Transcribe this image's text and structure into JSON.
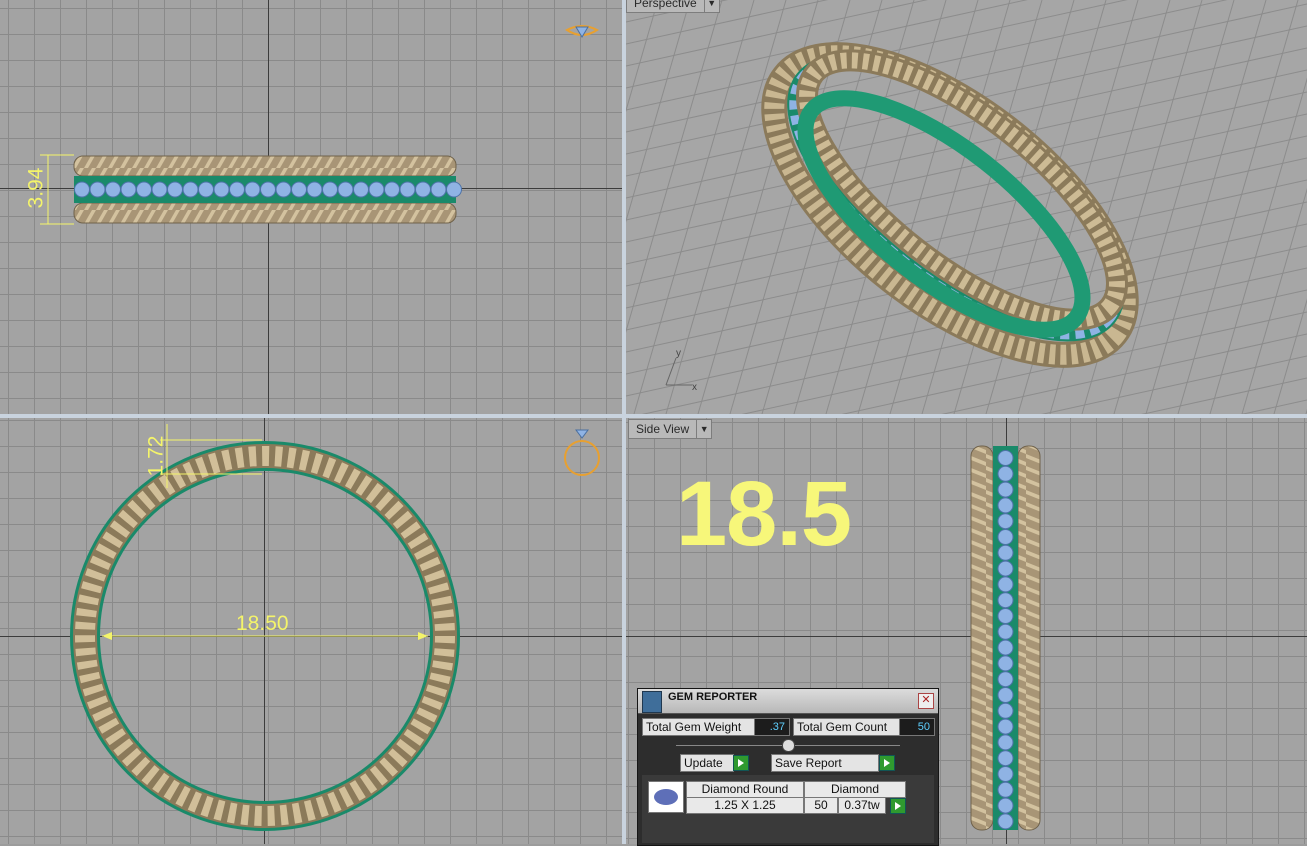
{
  "viewports": {
    "perspective_label": "Perspective",
    "side_label": "Side View"
  },
  "dimensions": {
    "width_top": "3.94",
    "thickness_front": "1.72",
    "diameter_front": "18.50",
    "size_big": "18.5"
  },
  "gizmo": {
    "y": "y",
    "x": "x"
  },
  "gem_reporter": {
    "title": "GEM REPORTER",
    "weight_label": "Total Gem Weight",
    "weight_value": ".37",
    "count_label": "Total Gem Count",
    "count_value": "50",
    "update_label": "Update",
    "save_label": "Save Report",
    "row": {
      "shape": "Diamond Round",
      "material": "Diamond",
      "size": "1.25 X 1.25",
      "count": "50",
      "weight": "0.37tw"
    }
  },
  "colors": {
    "rope_metal": "#b8a684",
    "gem_blue": "#8fb3e4",
    "prong_green": "#1a8a6a",
    "dimension_yellow": "#f4f46a"
  }
}
